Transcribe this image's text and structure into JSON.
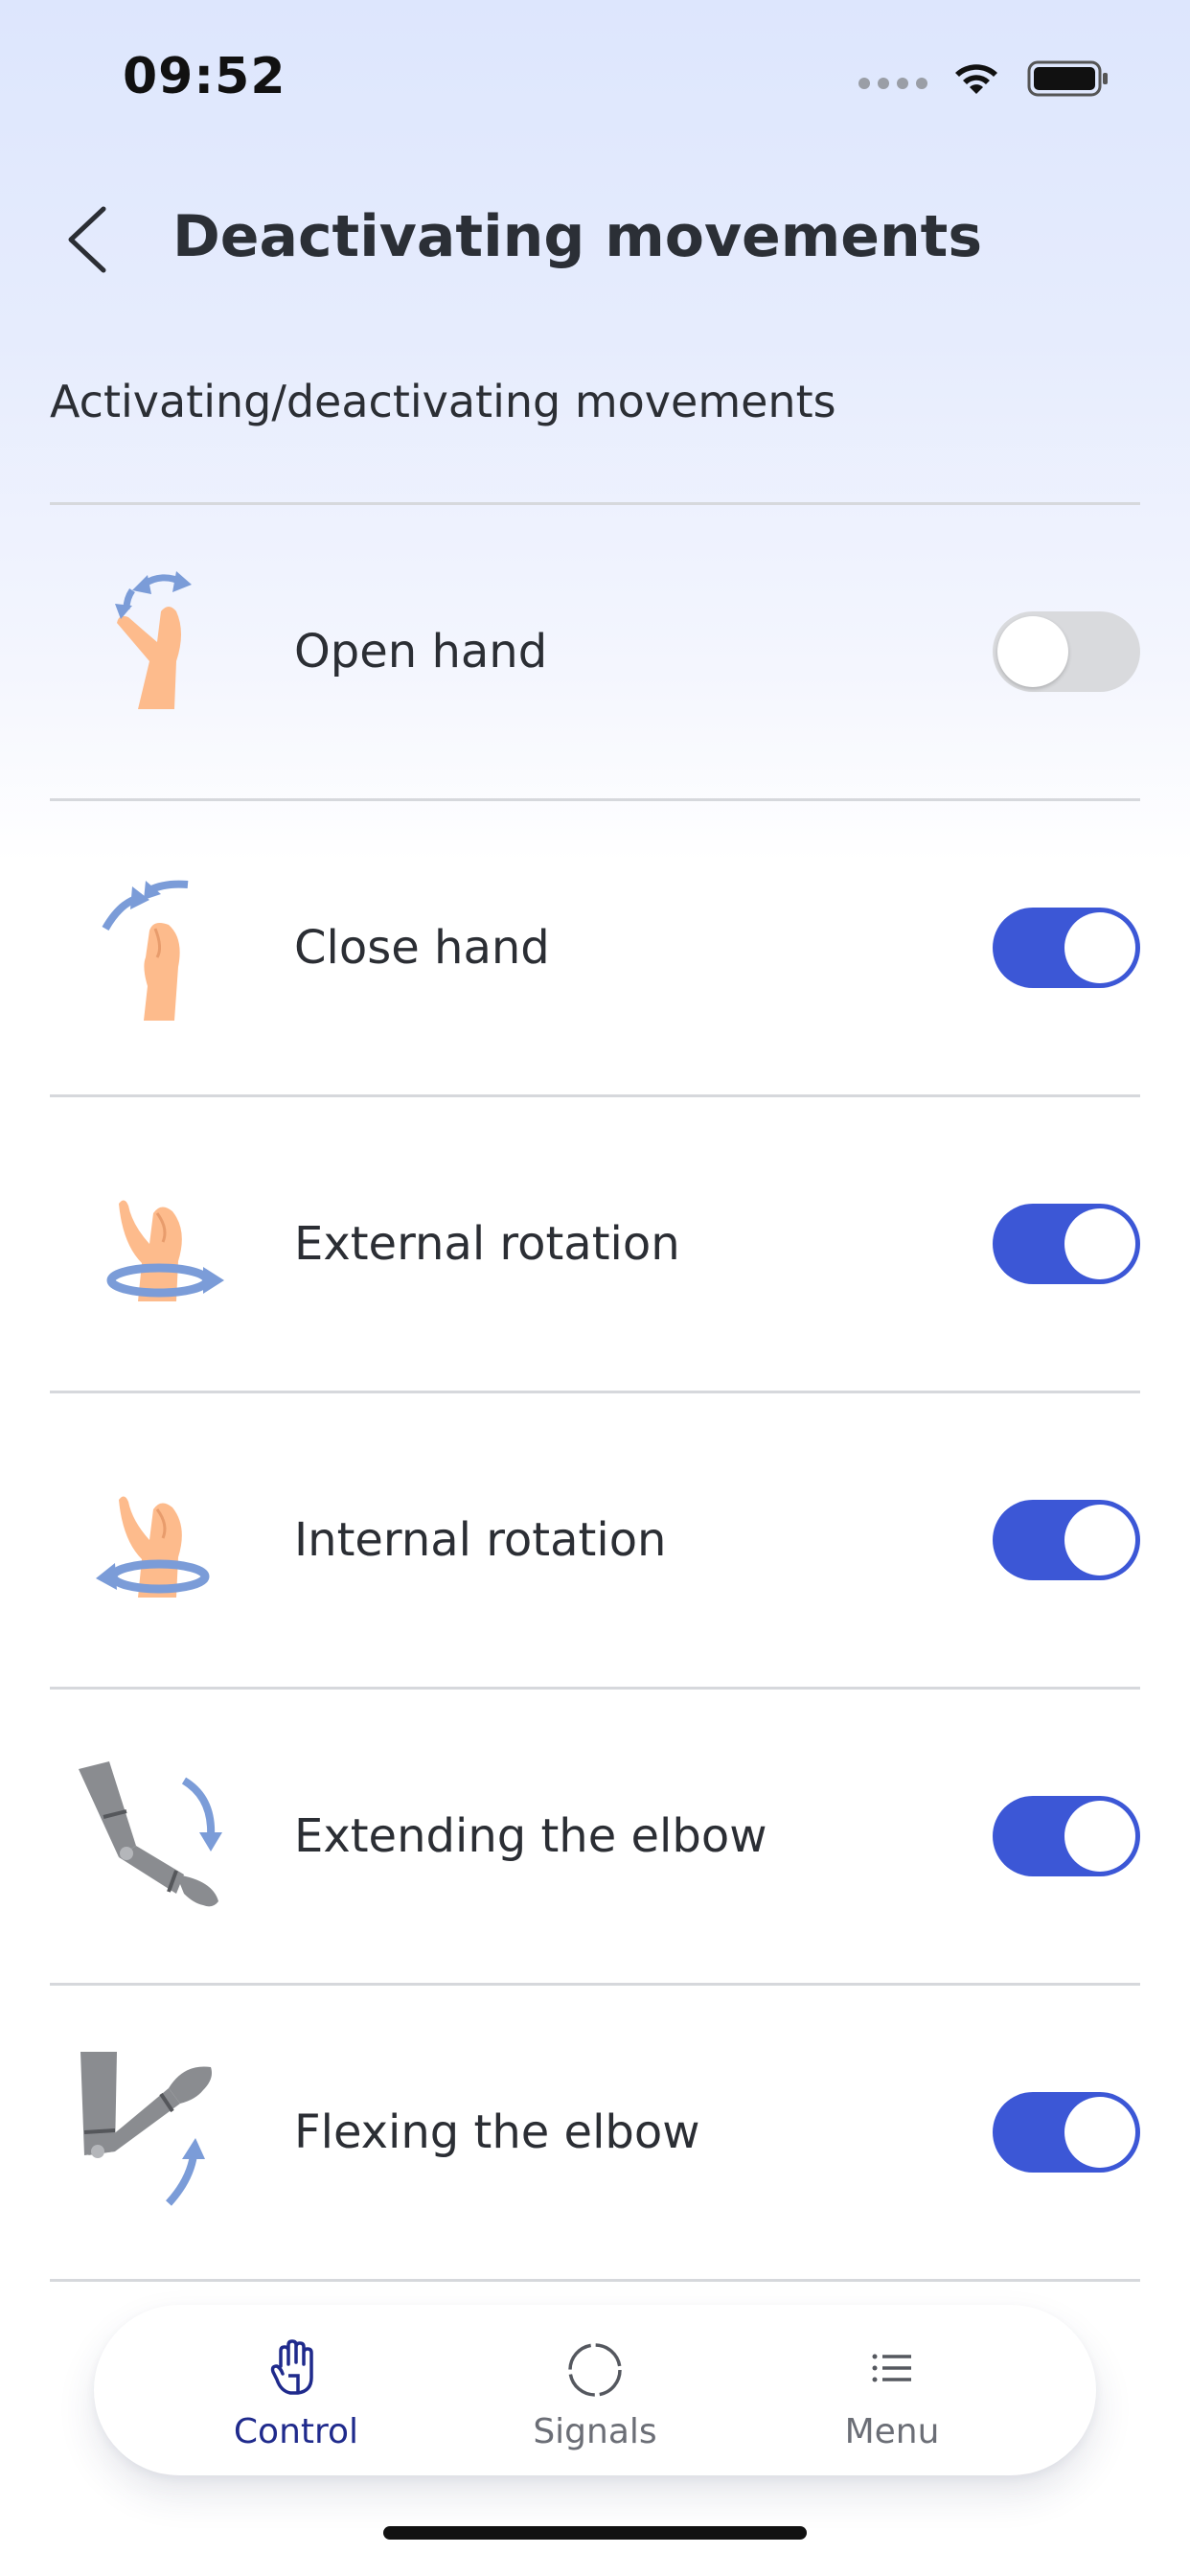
{
  "status_bar": {
    "time": "09:52"
  },
  "header": {
    "title": "Deactivating movements",
    "back_icon": "chevron-left-icon"
  },
  "section": {
    "label": "Activating/deactivating movements"
  },
  "movements": [
    {
      "label": "Open hand",
      "enabled": false,
      "icon": "open-hand-icon"
    },
    {
      "label": "Close hand",
      "enabled": true,
      "icon": "close-hand-icon"
    },
    {
      "label": "External rotation",
      "enabled": true,
      "icon": "external-rotation-icon"
    },
    {
      "label": "Internal rotation",
      "enabled": true,
      "icon": "internal-rotation-icon"
    },
    {
      "label": "Extending the elbow",
      "enabled": true,
      "icon": "elbow-extension-icon"
    },
    {
      "label": "Flexing the elbow",
      "enabled": true,
      "icon": "elbow-flexion-icon"
    }
  ],
  "tab_bar": {
    "tabs": [
      {
        "label": "Control",
        "active": true,
        "icon": "hand-icon"
      },
      {
        "label": "Signals",
        "active": false,
        "icon": "circle-dashed-icon"
      },
      {
        "label": "Menu",
        "active": false,
        "icon": "list-icon"
      }
    ]
  },
  "colors": {
    "accent": "#3c57d6",
    "toggle_off": "#d9dadd",
    "skin": "#fdbb8c",
    "arrow": "#7b9cd8",
    "prosthesis": "#8a8c90",
    "active_tab": "#1f2a8c"
  }
}
